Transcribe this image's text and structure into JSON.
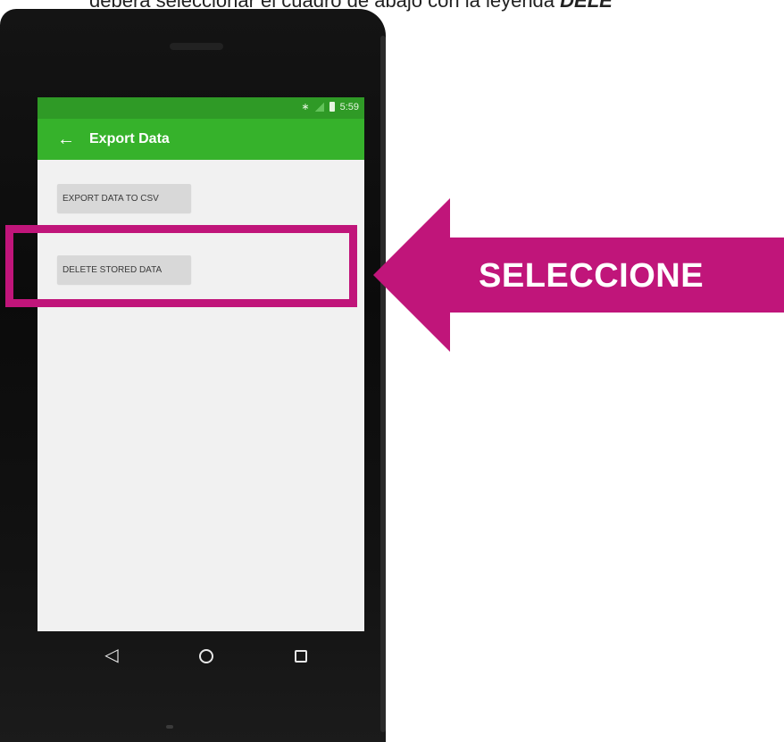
{
  "caption": {
    "text": "deberá seleccionar el cuadro de abajo con la leyenda ",
    "emphasis": "DELE"
  },
  "status_bar": {
    "time": "5:59",
    "icons": [
      "bluetooth-icon",
      "signal-icon",
      "battery-icon"
    ],
    "color": "#2f9a26"
  },
  "app_bar": {
    "title": "Export Data",
    "back_icon": "←",
    "color": "#36b22b"
  },
  "buttons": {
    "export_label": "EXPORT DATA TO CSV",
    "delete_label": "DELETE STORED DATA"
  },
  "nav_bar": {
    "back_icon": "◁",
    "home_icon": "home-icon",
    "recent_icon": "recent-apps-icon"
  },
  "annotation": {
    "arrow_label": "SELECCIONE",
    "accent_color": "#c0157a"
  }
}
